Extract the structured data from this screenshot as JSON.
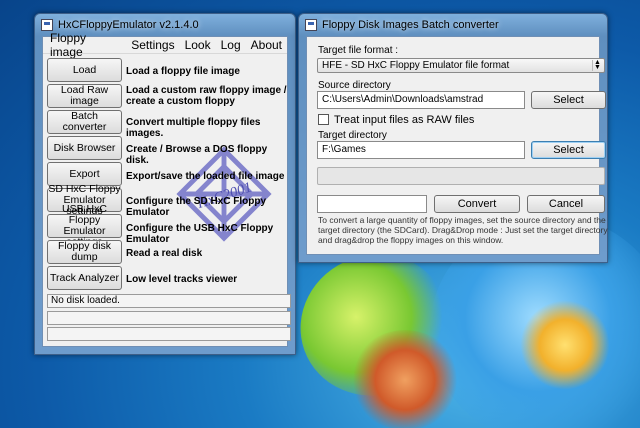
{
  "hxc_window": {
    "title": "HxCFloppyEmulator v2.1.4.0",
    "menu": [
      "Floppy image",
      "Settings",
      "Look",
      "Log",
      "About"
    ],
    "actions": [
      {
        "button": "Load",
        "description": "Load a floppy file image"
      },
      {
        "button": "Load Raw image",
        "description": "Load a custom raw floppy image / create a custom floppy"
      },
      {
        "button": "Batch converter",
        "description": "Convert multiple floppy files images."
      },
      {
        "button": "Disk Browser",
        "description": "Create / Browse a DOS floppy disk."
      },
      {
        "button": "Export",
        "description": "Export/save the loaded file image"
      },
      {
        "button": "SD HxC Floppy Emulator settings",
        "description": "Configure the SD HxC Floppy Emulator"
      },
      {
        "button": "USB HxC Floppy Emulator settings",
        "description": "Configure the USB HxC Floppy Emulator"
      },
      {
        "button": "Floppy disk dump",
        "description": "Read a real disk"
      },
      {
        "button": "Track Analyzer",
        "description": "Low level tracks viewer"
      }
    ],
    "status": "No disk loaded.",
    "logo_text": "HxC2001"
  },
  "batch_window": {
    "title": "Floppy Disk Images Batch converter",
    "target_format_label": "Target file format :",
    "target_format_value": "HFE - SD HxC Floppy Emulator file format",
    "source_label": "Source directory",
    "source_value": "C:\\Users\\Admin\\Downloads\\amstrad",
    "select_label": "Select",
    "raw_checkbox_label": "Treat input files as RAW files",
    "raw_checked": false,
    "target_label": "Target directory",
    "target_value": "F:\\Games",
    "convert_label": "Convert",
    "cancel_label": "Cancel",
    "help_text": "To convert a large quantity of floppy images, set the source directory and the target directory (the SDCard). Drag&Drop mode : Just set the target directory and drag&drop the floppy images on this window."
  },
  "colors": {
    "desktop": "#1a7bc4",
    "window_frame": "#6e9ccc",
    "logo_purple": "#7272c8"
  }
}
